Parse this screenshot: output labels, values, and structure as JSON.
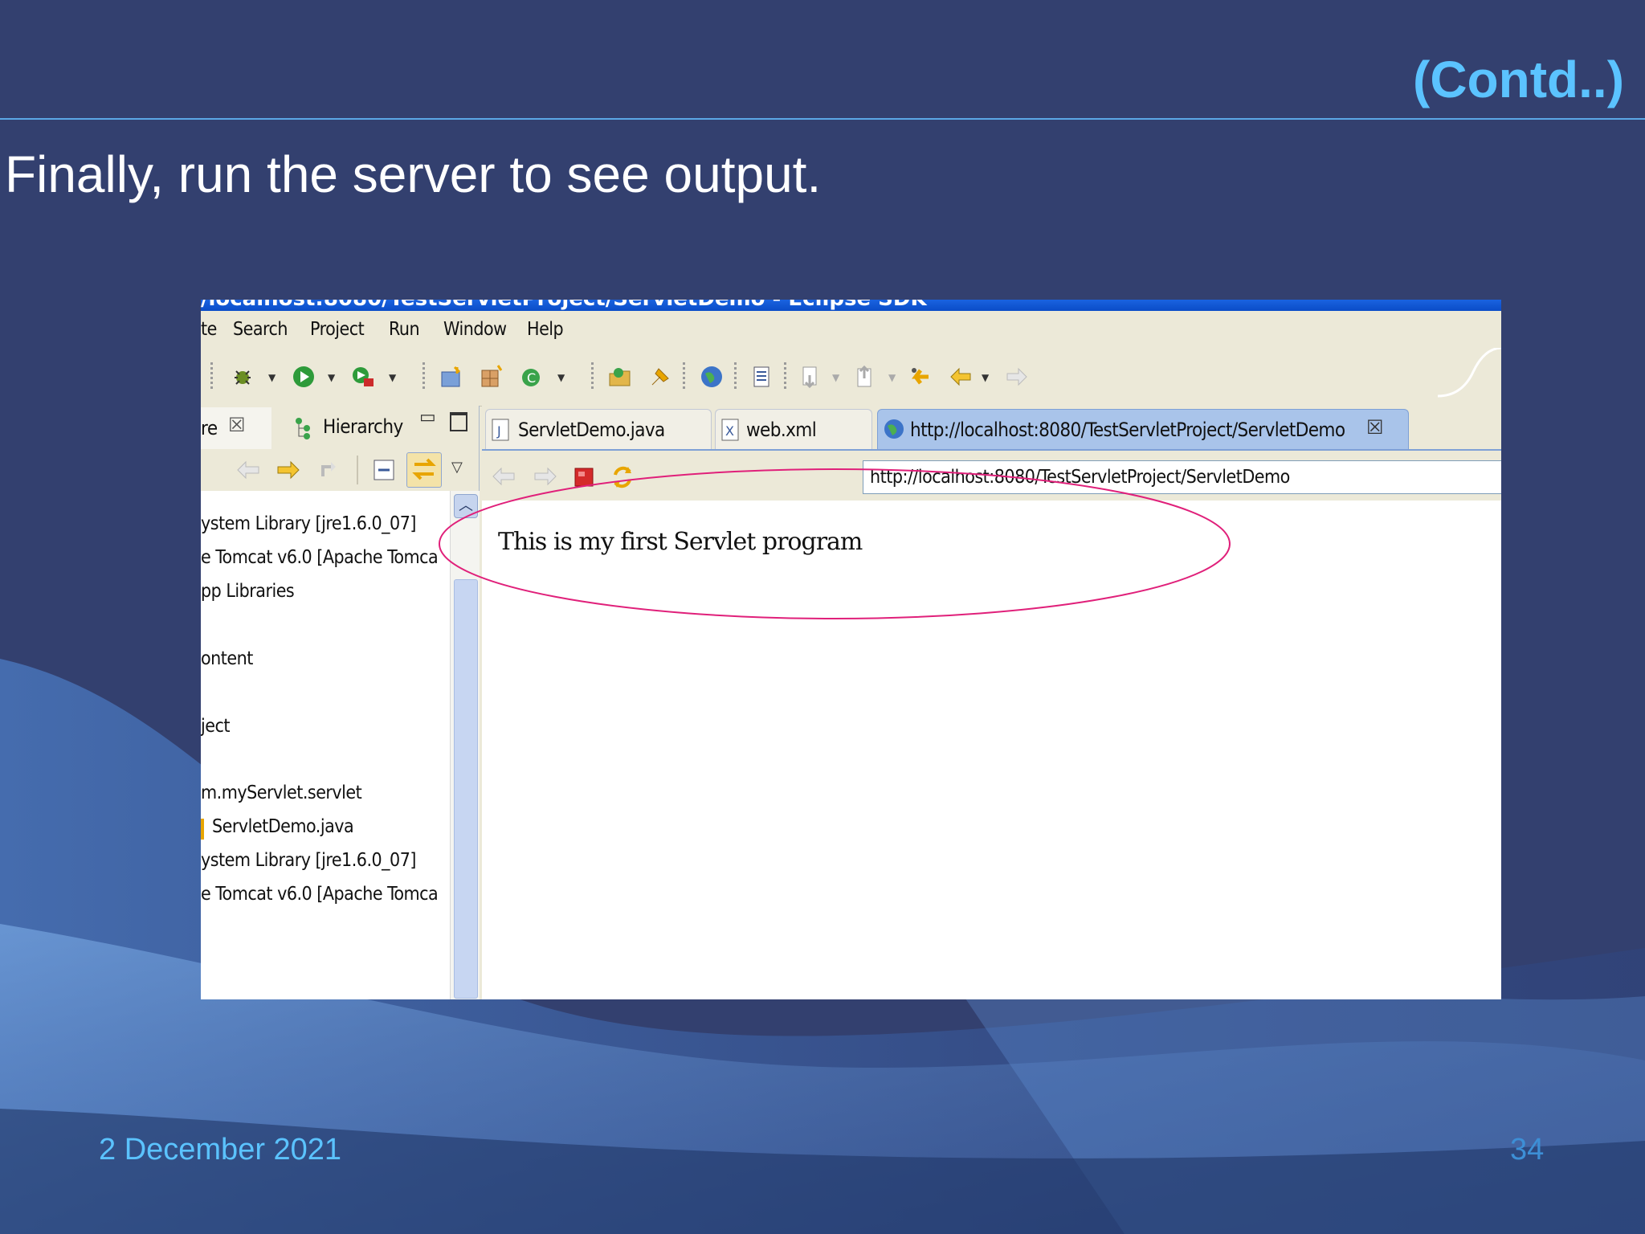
{
  "slide": {
    "corner_title": "(Contd..)",
    "heading": "Finally, run the server to see output.",
    "date": "2 December 2021",
    "page_number": "34"
  },
  "window": {
    "title": "/localhost:8080/TestServletProject/ServletDemo - Eclipse SDK"
  },
  "menu": {
    "items": [
      "te",
      "Search",
      "Project",
      "Run",
      "Window",
      "Help"
    ]
  },
  "left_view": {
    "tabs": [
      {
        "label": "re",
        "icon": "close-icon"
      },
      {
        "label": "Hierarchy",
        "icon": "hierarchy-icon"
      }
    ],
    "tree_items": [
      "ystem Library [jre1.6.0_07]",
      "e Tomcat v6.0 [Apache Tomca",
      "pp Libraries",
      "ontent",
      "ject",
      "m.myServlet.servlet",
      "ServletDemo.java",
      "ystem Library [jre1.6.0_07]",
      "e Tomcat v6.0 [Apache Tomca"
    ]
  },
  "editor": {
    "tabs": [
      {
        "label": "ServletDemo.java",
        "icon": "java-file-icon",
        "active": false
      },
      {
        "label": "web.xml",
        "icon": "xml-file-icon",
        "active": false
      },
      {
        "label": "http://localhost:8080/TestServletProject/ServletDemo",
        "icon": "globe-icon",
        "active": true
      }
    ],
    "browser": {
      "url": "http://localhost:8080/TestServletProject/ServletDemo",
      "content_text": "This is my first Servlet program"
    }
  },
  "colors": {
    "slide_background": "#33406f",
    "accent": "#5bc3ff",
    "annotation_ellipse": "#e0207a"
  }
}
